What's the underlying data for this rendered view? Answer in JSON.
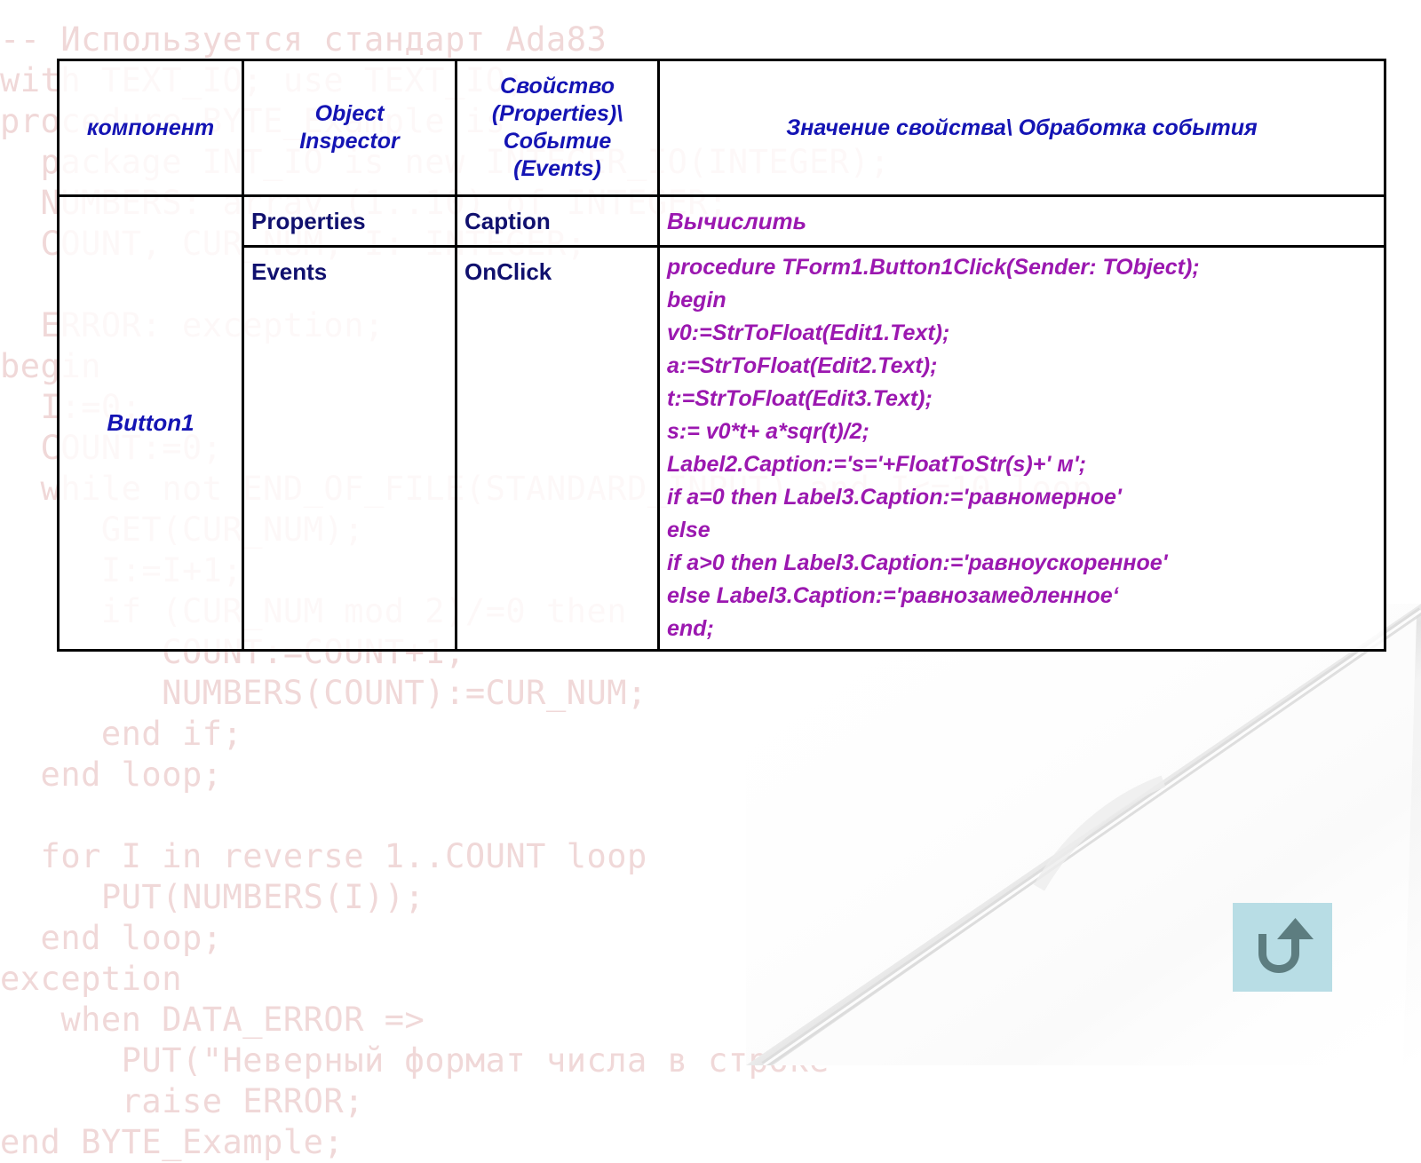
{
  "slide": {
    "background_watermark": "-- Используется стандарт Ada83\nwith TEXT_IO; use TEXT_IO;\nprocedure BYTE_Example is\n  package INT_IO is new INTEGER_IO(INTEGER);\n  NUMBERS: array (1..10) of INTEGER;\n  COUNT, CUR_NUM, I: INTEGER;\n\n  ERROR: exception;\nbegin\n  I:=0;\n  COUNT:=0;\n  while not END_OF_FILE(STANDARD_INPUT) and I<=10 loop\n     GET(CUR_NUM);\n     I:=I+1;\n     if (CUR_NUM mod 2)/=0 then\n        COUNT:=COUNT+1;\n        NUMBERS(COUNT):=CUR_NUM;\n     end if;\n  end loop;\n\n  for I in reverse 1..COUNT loop\n     PUT(NUMBERS(I));\n  end loop;\nexception\n   when DATA_ERROR =>\n      PUT(\"Неверный формат числа в строке\n      raise ERROR;\nend BYTE_Example;"
  },
  "table": {
    "headers": {
      "component": "компонент",
      "object_inspector": "Object\nInspector",
      "property_event": "Свойство\n(Properties)\\\nСобытие\n(Events)",
      "value_handler": "Значение свойства\\ Обработка события"
    },
    "component_name": "Button1",
    "rows": [
      {
        "inspector": "Properties",
        "property": "Caption",
        "value": "Вычислить"
      },
      {
        "inspector": "Events",
        "property": "OnClick",
        "code_lines": [
          "procedure TForm1.Button1Click(Sender: TObject);",
          "begin",
          "v0:=StrToFloat(Edit1.Text);",
          "a:=StrToFloat(Edit2.Text);",
          "t:=StrToFloat(Edit3.Text);",
          "s:= v0*t+ a*sqr(t)/2;",
          "Label2.Caption:='s='+FloatToStr(s)+' м';",
          "if a=0 then Label3.Caption:='равномерное'",
          "else",
          "if a>0 then Label3.Caption:='равноускоренное'",
          "else Label3.Caption:='равнозамедленное‘",
          "end;"
        ]
      }
    ]
  },
  "controls": {
    "return_button_icon": "u-turn-arrow-icon"
  },
  "colors": {
    "header_text": "#1414b4",
    "label_text": "#10106e",
    "code_text": "#9b18b0",
    "table_border": "#000000",
    "return_button_bg": "#b8dde5",
    "return_button_icon": "#5d7d80",
    "watermark_text": "#f0d8d8"
  }
}
